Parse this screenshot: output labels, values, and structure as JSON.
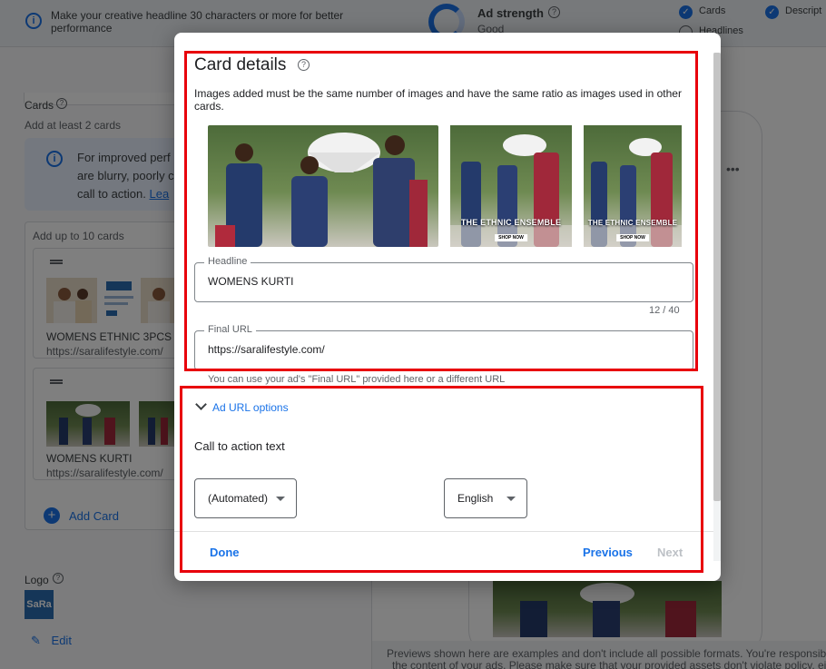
{
  "tip": {
    "text": "Make your creative headline 30 characters or more for better performance"
  },
  "ad_strength": {
    "title": "Ad strength",
    "value": "Good"
  },
  "checklist": [
    {
      "label": "Cards",
      "checked": true
    },
    {
      "label": "Descript",
      "checked": true
    },
    {
      "label": "Headlines",
      "checked": false
    }
  ],
  "cards_section": {
    "title": "Cards",
    "subtitle": "Add at least 2 cards",
    "info_lines": [
      "For improved perf",
      "are blurry, poorly c",
      "call to action."
    ],
    "info_link": "Lea",
    "list_header": "Add up to 10 cards",
    "items": [
      {
        "title": "WOMENS ETHNIC 3PCS",
        "url": "https://saralifestyle.com/"
      },
      {
        "title": "WOMENS KURTI",
        "url": "https://saralifestyle.com/"
      }
    ],
    "add_card": "Add Card"
  },
  "logo_section": {
    "title": "Logo",
    "logo_text": "SaRa",
    "edit": "Edit"
  },
  "preview_note": {
    "line1": "Previews shown here are examples and don't include all possible formats. You're responsibl",
    "line2": "the content of your ads. Please make sure that your provided assets don't violate policy, eith"
  },
  "modal": {
    "title": "Card details",
    "description": "Images added must be the same number of images and have the same ratio as images used in other cards.",
    "image_caption": "THE ETHNIC ENSEMBLE",
    "image_button": "SHOP NOW",
    "headline": {
      "label": "Headline",
      "value": "WOMENS KURTI",
      "counter": "12 / 40"
    },
    "final_url": {
      "label": "Final URL",
      "value": "https://saralifestyle.com/",
      "helper": "You can use your ad's \"Final URL\" provided here or a different URL"
    },
    "url_options": "Ad URL options",
    "cta_title": "Call to action text",
    "cta_select": "(Automated)",
    "language_select": "English",
    "buttons": {
      "done": "Done",
      "previous": "Previous",
      "next": "Next"
    }
  },
  "colors": {
    "accent": "#1a73e8",
    "highlight": "#e8000b",
    "disabled": "#bdc1c6"
  }
}
